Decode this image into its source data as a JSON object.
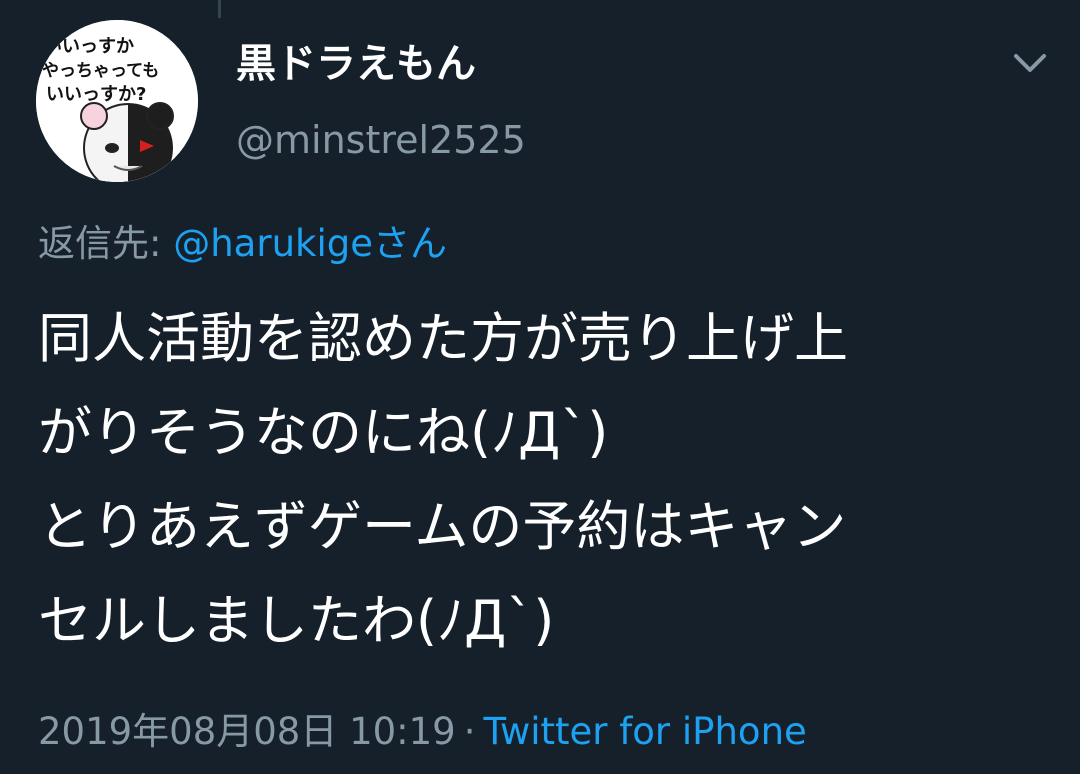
{
  "colors": {
    "background": "#15202b",
    "primary_text": "#ffffff",
    "secondary_text": "#8899a6",
    "link": "#1da1f2"
  },
  "user": {
    "display_name": "黒ドラえもん",
    "handle": "@minstrel2525",
    "avatar_text": [
      "いいっすか",
      "やっちゃっても",
      "いいっすか?"
    ]
  },
  "menu": {
    "icon": "chevron-down-icon"
  },
  "reply": {
    "prefix": "返信先: ",
    "mention": "@harukigeさん"
  },
  "tweet": {
    "lines": [
      "同人活動を認めた方が売り上げ上",
      "がりそうなのにね(ﾉД`)",
      "とりあえずゲームの予約はキャン",
      "セルしましたわ(ﾉД`)"
    ]
  },
  "meta": {
    "timestamp": "2019年08月08日 10:19",
    "separator": "·",
    "source": "Twitter for iPhone"
  }
}
